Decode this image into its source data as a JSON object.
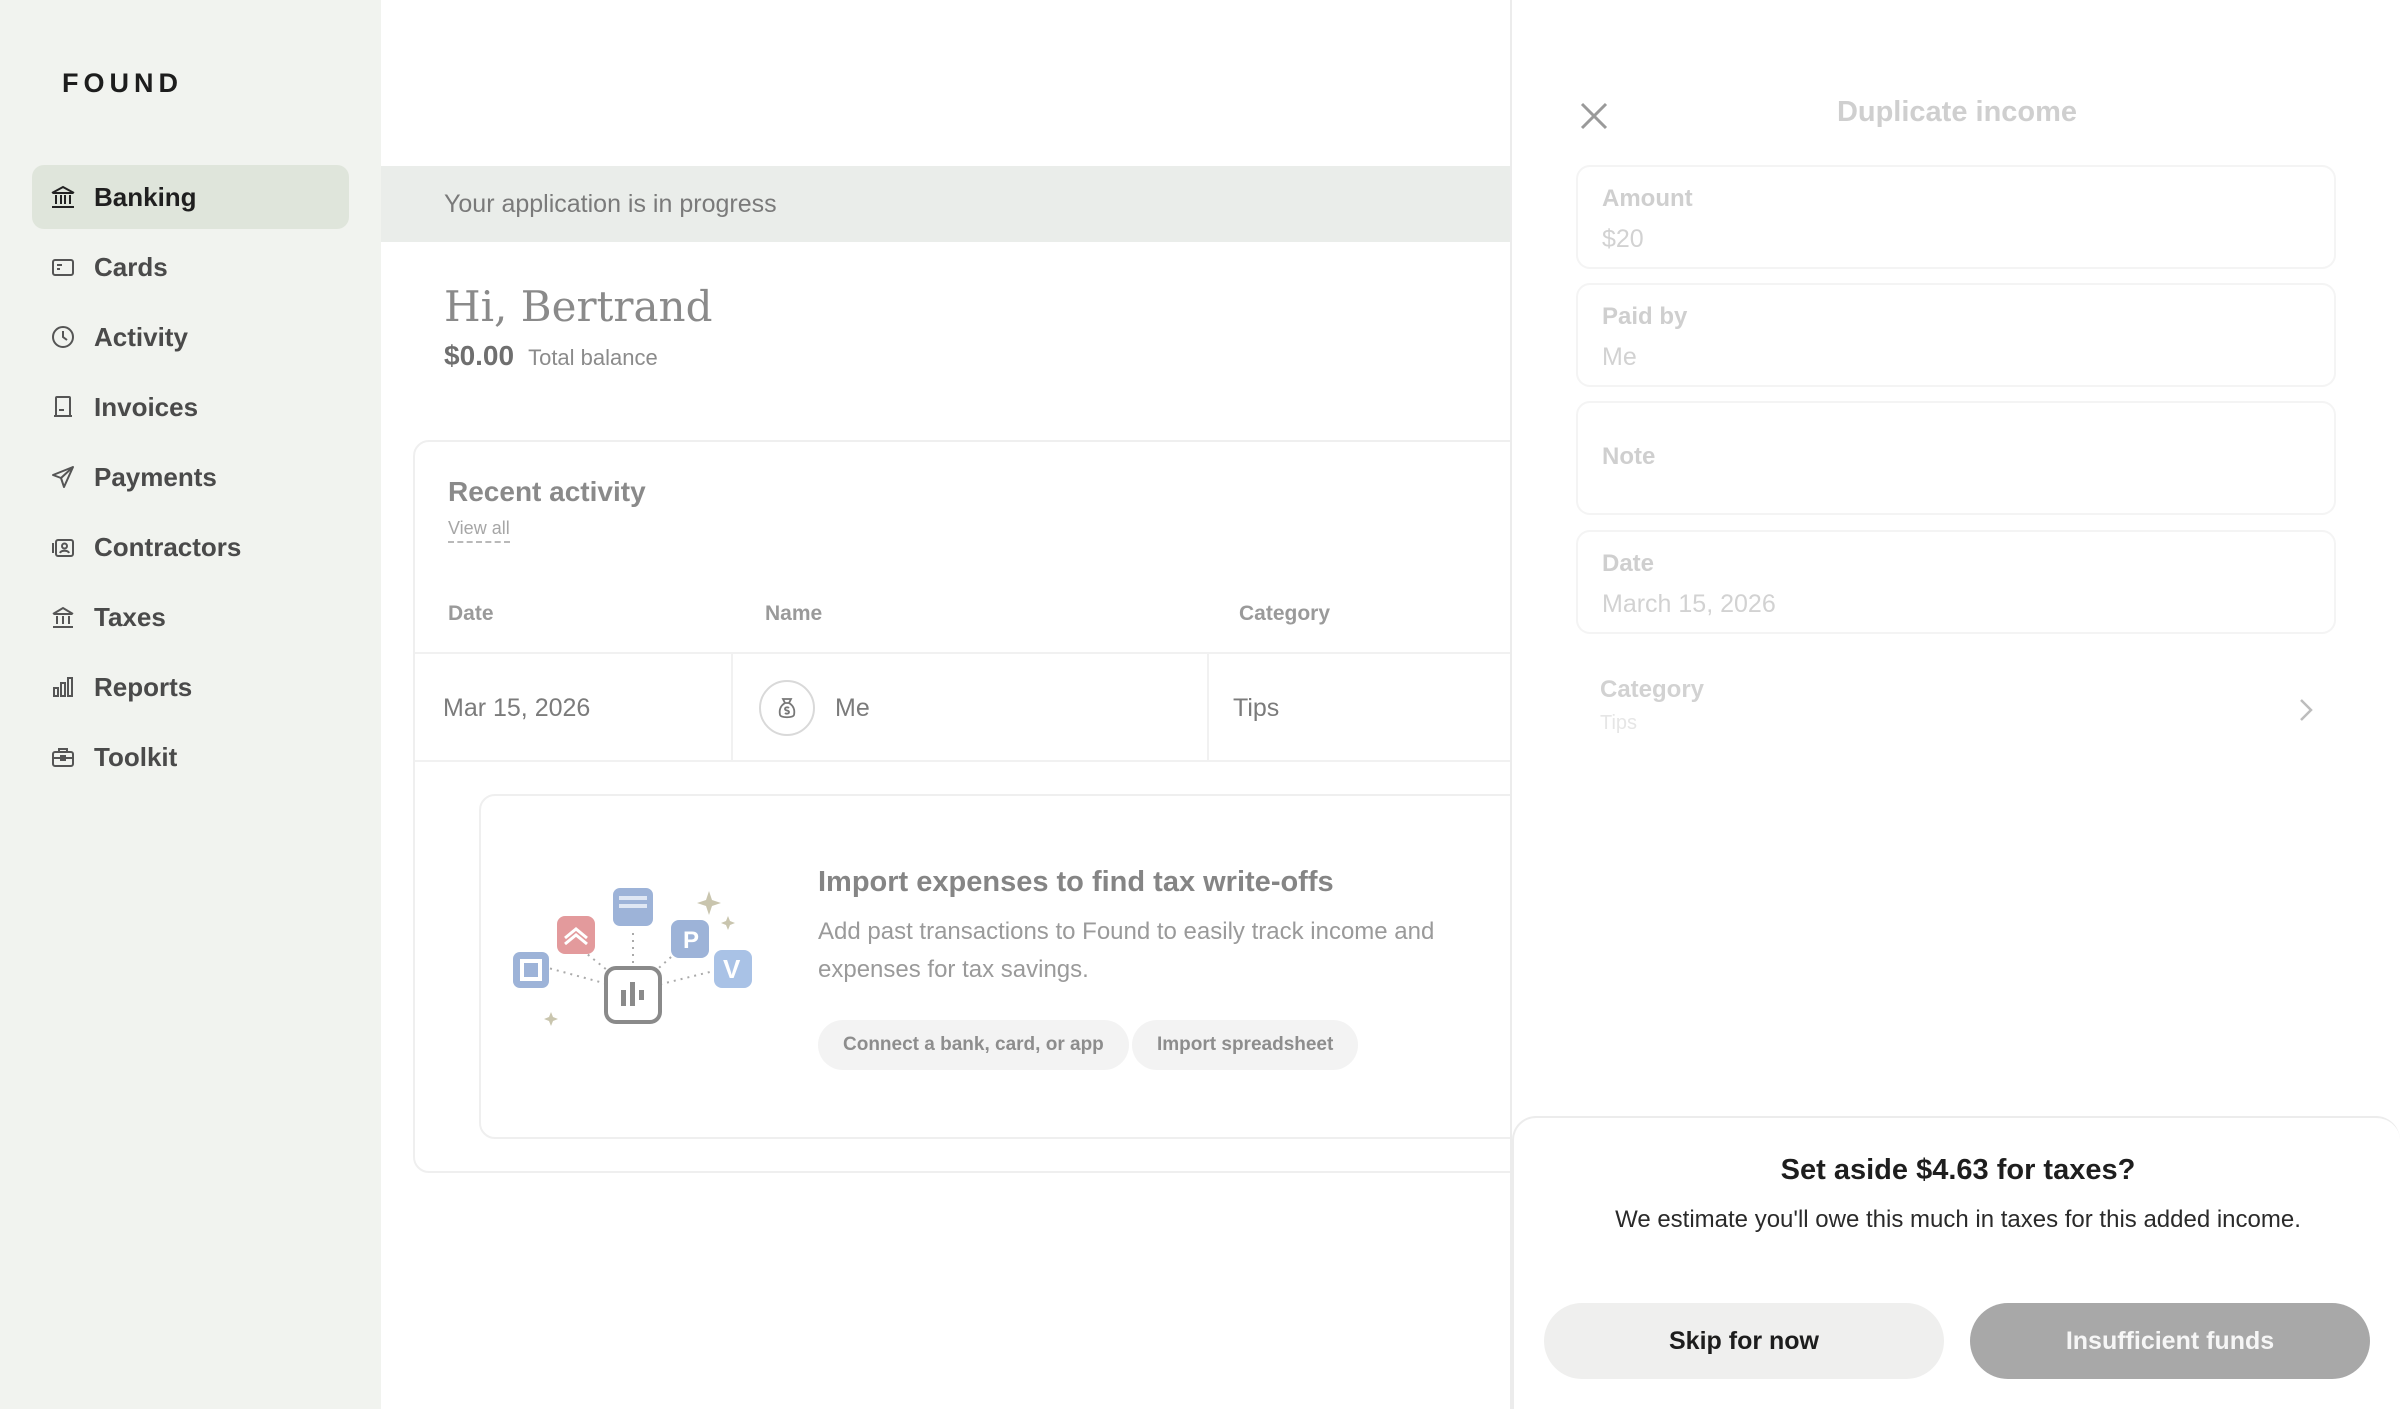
{
  "sidebar": {
    "logo": "FOUND",
    "items": [
      {
        "label": "Banking",
        "icon": "bank-icon",
        "active": true
      },
      {
        "label": "Cards",
        "icon": "card-icon"
      },
      {
        "label": "Activity",
        "icon": "clock-icon"
      },
      {
        "label": "Invoices",
        "icon": "invoice-icon"
      },
      {
        "label": "Payments",
        "icon": "send-icon"
      },
      {
        "label": "Contractors",
        "icon": "contractor-icon"
      },
      {
        "label": "Taxes",
        "icon": "government-icon"
      },
      {
        "label": "Reports",
        "icon": "bar-chart-icon"
      },
      {
        "label": "Toolkit",
        "icon": "briefcase-icon"
      }
    ]
  },
  "main": {
    "banner": "Your application is in progress",
    "greeting": "Hi, Bertrand",
    "balance_amount": "$0.00",
    "balance_label": "Total balance",
    "activity": {
      "title": "Recent activity",
      "view_all": "View all",
      "columns": [
        "Date",
        "Name",
        "Category"
      ],
      "rows": [
        {
          "date": "Mar 15, 2026",
          "name": "Me",
          "category": "Tips"
        }
      ]
    },
    "import": {
      "title": "Import expenses to find tax write-offs",
      "description": "Add past transactions to Found to easily track income and expenses for tax savings.",
      "connect_button": "Connect a bank, card, or app",
      "spreadsheet_button": "Import spreadsheet"
    }
  },
  "panel": {
    "title": "Duplicate income",
    "fields": [
      {
        "label": "Amount",
        "value": "$20"
      },
      {
        "label": "Paid by",
        "value": "Me"
      },
      {
        "label": "Note",
        "value": ""
      },
      {
        "label": "Date",
        "value": "March 15, 2026"
      }
    ],
    "category_label": "Category",
    "category_value": "Tips"
  },
  "sheet": {
    "title": "Set aside $4.63 for taxes?",
    "description": "We estimate you'll owe this much in taxes for this added income.",
    "skip_button": "Skip for now",
    "insufficient_button": "Insufficient funds"
  }
}
